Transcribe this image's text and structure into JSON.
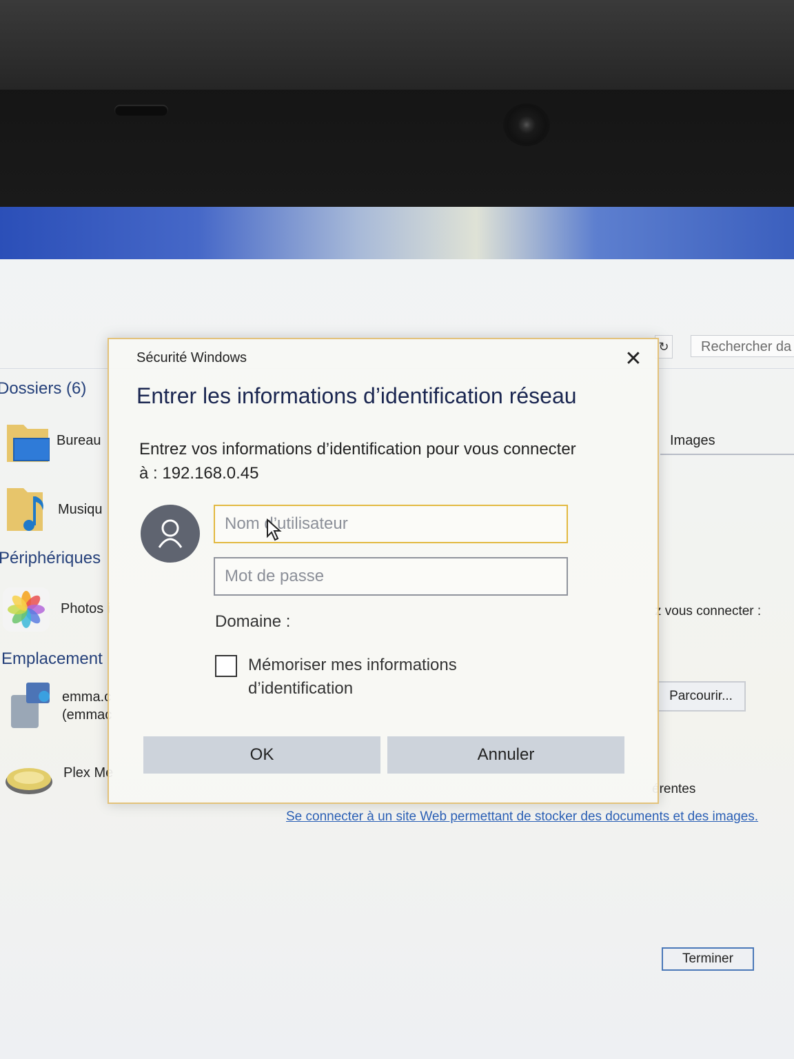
{
  "explorer": {
    "search_placeholder": "Rechercher da",
    "folders_heading": "Dossiers (6)",
    "folders": [
      {
        "label": "Bureau"
      },
      {
        "label": "Musiqu"
      }
    ],
    "devices_heading": "Périphériques",
    "devices": [
      {
        "label": "Photos i"
      }
    ],
    "locations_heading": "Emplacement",
    "locations": [
      {
        "line1": "emma.c",
        "line2": "(emmac"
      },
      {
        "line1": "Plex Me",
        "line2": ""
      }
    ],
    "images_tab": "Images",
    "connect_hint": "z vous connecter :",
    "browse_button": "Parcourir...",
    "other_text": "érentes",
    "web_link": "Se connecter à un site Web permettant de stocker des documents et des images.",
    "finish_button": "Terminer"
  },
  "dialog": {
    "caption": "Sécurité Windows",
    "close_glyph": "✕",
    "title": "Entrer les informations d’identification réseau",
    "description_line1": "Entrez vos informations d’identification pour vous connecter",
    "description_line2": "à : 192.168.0.45",
    "username_placeholder": "Nom d’utilisateur",
    "password_placeholder": "Mot de passe",
    "domain_label": "Domaine :",
    "remember_label_line1": "Mémoriser mes informations",
    "remember_label_line2": "d’identification",
    "ok_label": "OK",
    "cancel_label": "Annuler"
  },
  "colors": {
    "dialog_border": "#e3c27a",
    "username_focus": "#e2b940",
    "title_text": "#1a2650",
    "link": "#2a5fb5"
  }
}
